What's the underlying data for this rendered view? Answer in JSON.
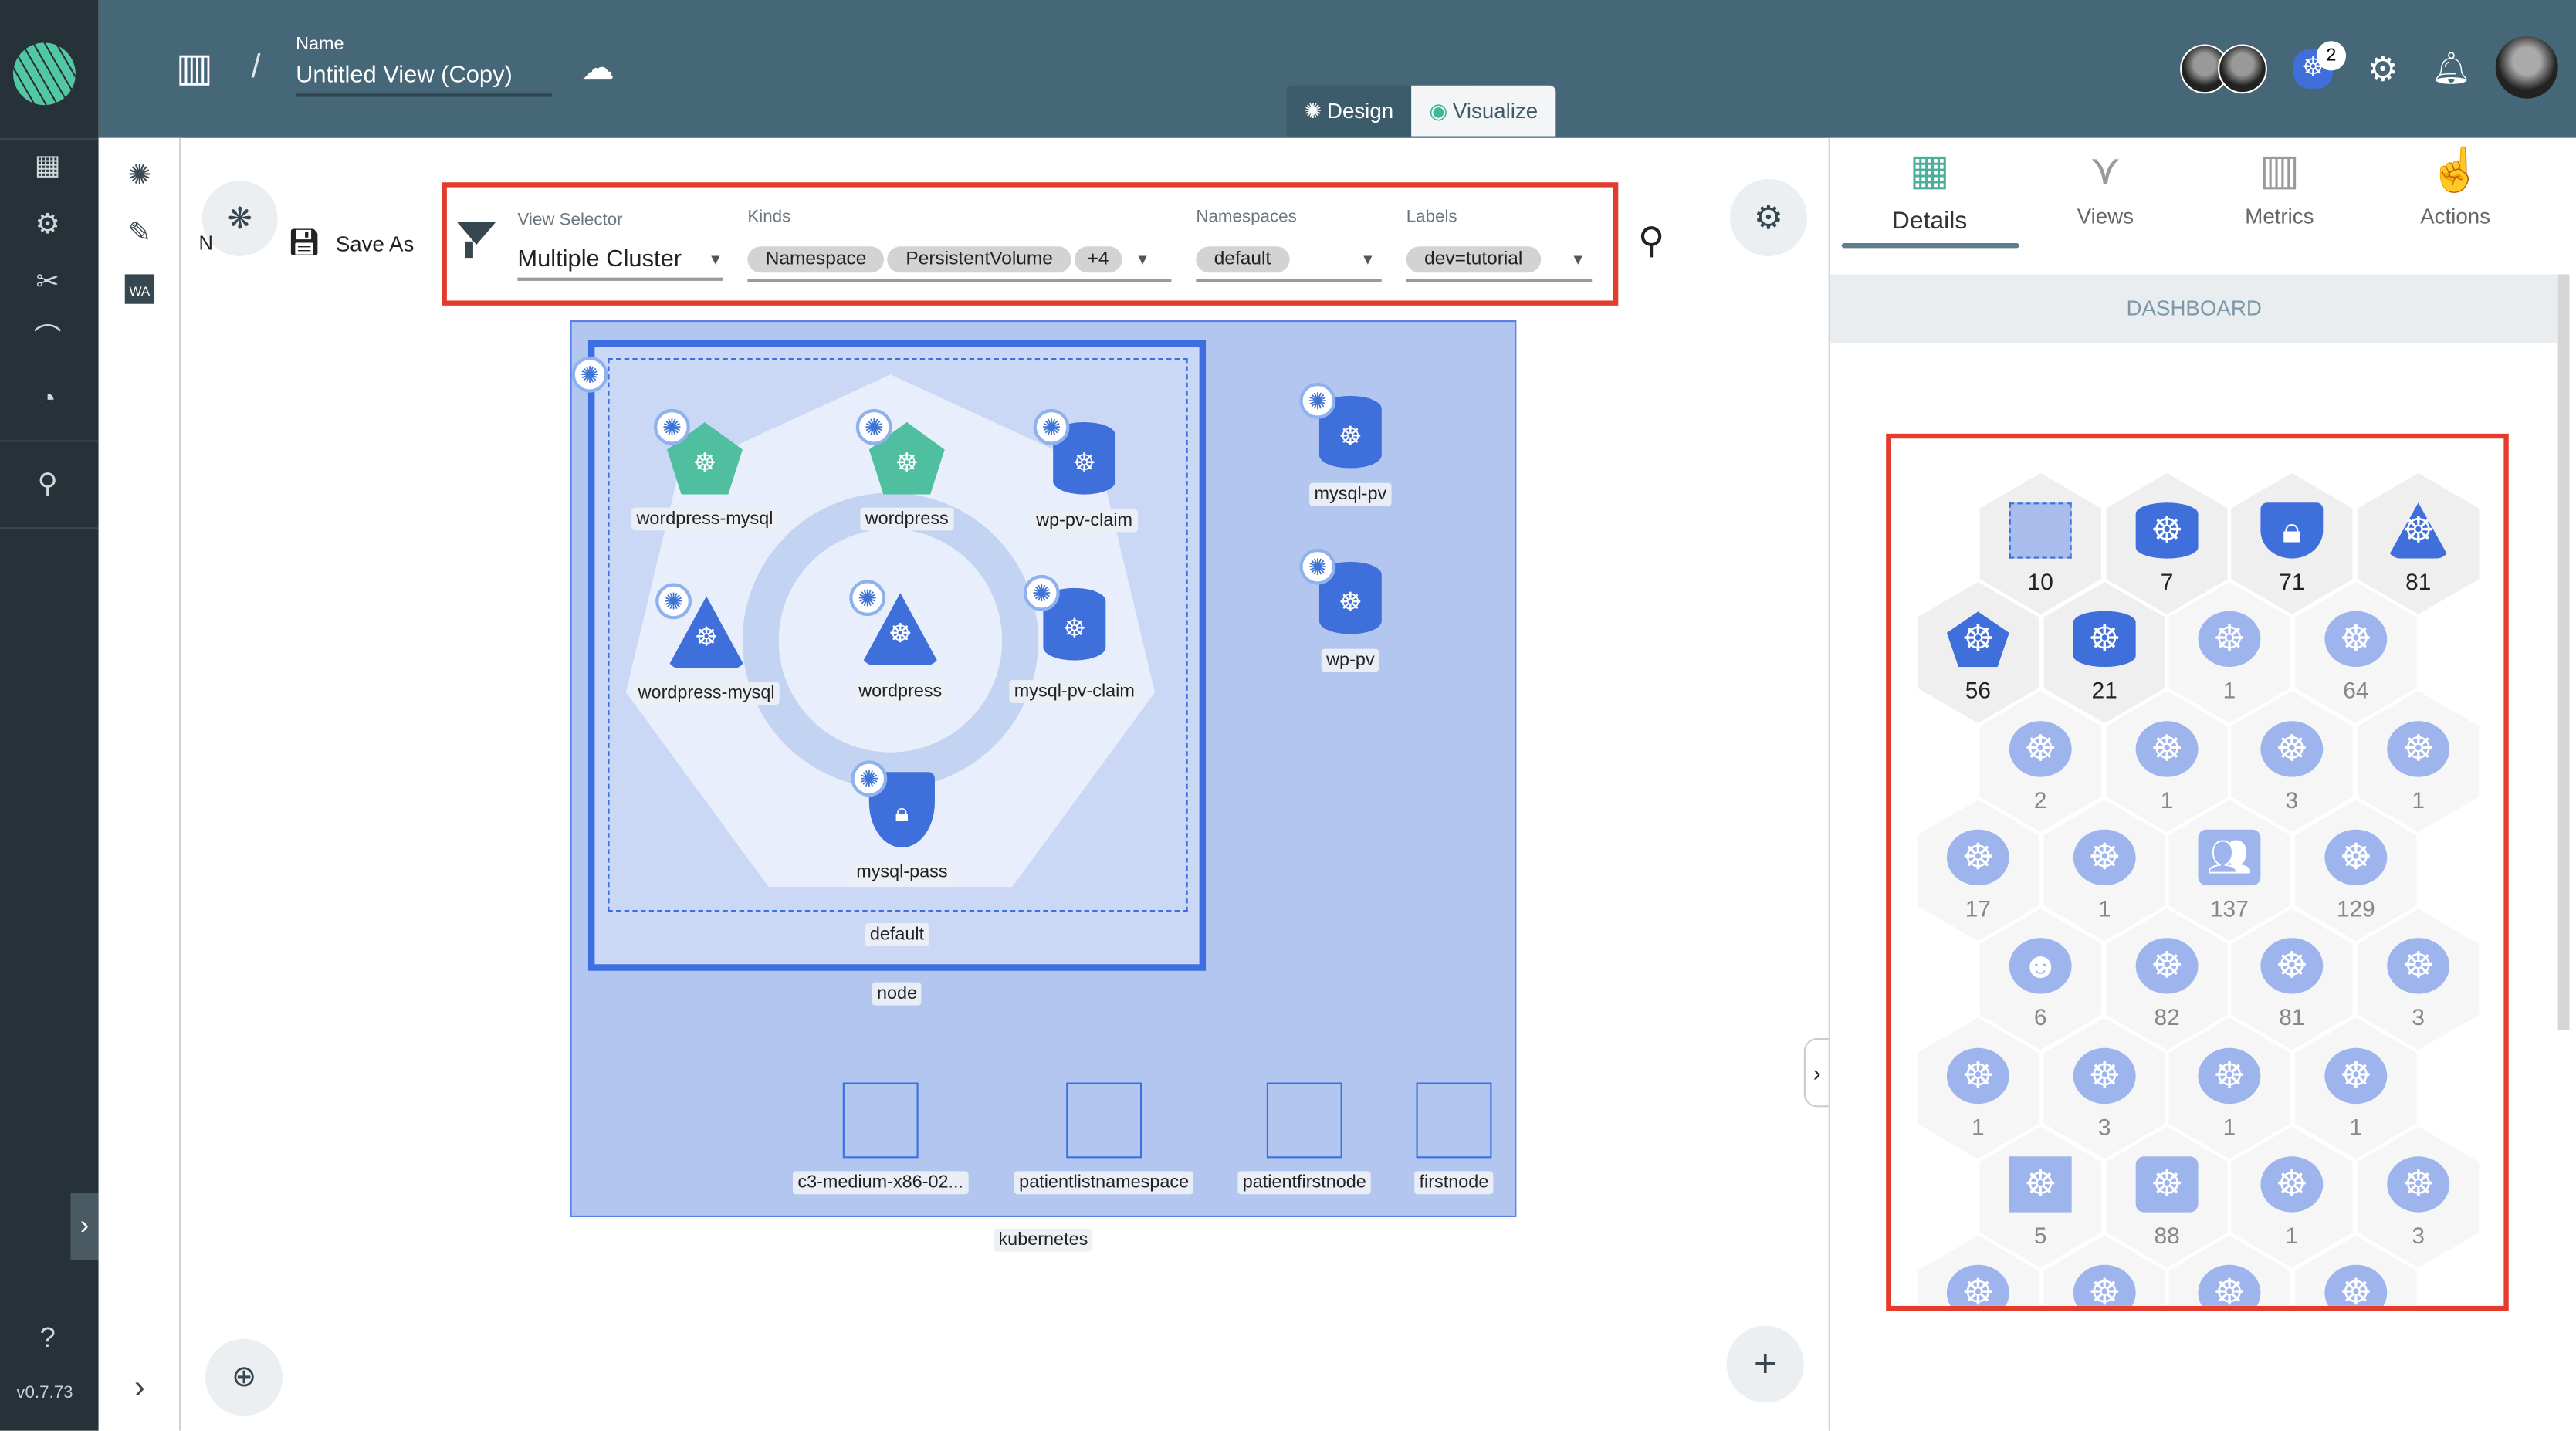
{
  "header": {
    "name_label": "Name",
    "title": "Untitled View (Copy)",
    "mode_design": "Design",
    "mode_visualize": "Visualize",
    "notification_count": "2"
  },
  "app": {
    "version": "v0.7.73"
  },
  "toolbar": {
    "save_as": "Save As",
    "obscured_label": "N"
  },
  "filters": {
    "view_selector": {
      "label": "View Selector",
      "value": "Multiple Cluster"
    },
    "kinds": {
      "label": "Kinds",
      "chips": [
        "Namespace",
        "PersistentVolume",
        "+4"
      ]
    },
    "namespaces": {
      "label": "Namespaces",
      "chips": [
        "default"
      ]
    },
    "labels": {
      "label": "Labels",
      "chips": [
        "dev=tutorial"
      ]
    }
  },
  "graph": {
    "outer_label": "kubernetes",
    "node_label": "node",
    "namespace_label": "default",
    "nodes": [
      {
        "label": "wordpress-mysql",
        "shape": "pentagon-teal"
      },
      {
        "label": "wordpress",
        "shape": "pentagon-teal"
      },
      {
        "label": "wp-pv-claim",
        "shape": "cylinder"
      },
      {
        "label": "wordpress-mysql",
        "shape": "triangle"
      },
      {
        "label": "wordpress",
        "shape": "triangle"
      },
      {
        "label": "mysql-pv-claim",
        "shape": "cylinder"
      },
      {
        "label": "mysql-pass",
        "shape": "shield"
      },
      {
        "label": "mysql-pv",
        "shape": "cylinder"
      },
      {
        "label": "wp-pv",
        "shape": "cylinder"
      }
    ],
    "clusters": [
      "c3-medium-x86-02...",
      "patientlistnamespace",
      "patientfirstnode",
      "firstnode"
    ]
  },
  "panel": {
    "tabs": [
      {
        "label": "Details",
        "icon": "dashboard-grid-icon",
        "active": true
      },
      {
        "label": "Views",
        "icon": "views-icon"
      },
      {
        "label": "Metrics",
        "icon": "chart-icon"
      },
      {
        "label": "Actions",
        "icon": "touch-icon"
      }
    ],
    "section": "DASHBOARD",
    "colors": {
      "solid": "#3f6fdb",
      "light": "#9db5ec",
      "accent": "#4caf9a"
    },
    "hex_rows": [
      [
        {
          "icon": "namespace-box",
          "count": "10",
          "solid": true
        },
        {
          "icon": "persistent-volume",
          "count": "7",
          "solid": true
        },
        {
          "icon": "secret",
          "count": "71",
          "solid": true
        },
        {
          "icon": "k8s-triangle",
          "count": "81",
          "solid": true
        }
      ],
      [
        {
          "icon": "k8s-pentagon",
          "count": "56",
          "solid": true
        },
        {
          "icon": "persistent-volume",
          "count": "21",
          "solid": true
        },
        {
          "icon": "k8s-circle",
          "count": "1"
        },
        {
          "icon": "k8s-circle",
          "count": "64"
        }
      ],
      [
        {
          "icon": "k8s-circle",
          "count": "2"
        },
        {
          "icon": "k8s-circle",
          "count": "1"
        },
        {
          "icon": "k8s-circle",
          "count": "3"
        },
        {
          "icon": "k8s-circle",
          "count": "1"
        }
      ],
      [
        {
          "icon": "k8s-circle",
          "count": "17"
        },
        {
          "icon": "k8s-circle",
          "count": "1"
        },
        {
          "icon": "users",
          "count": "137"
        },
        {
          "icon": "k8s-circle",
          "count": "129"
        }
      ],
      [
        {
          "icon": "devil",
          "count": "6"
        },
        {
          "icon": "k8s-circle",
          "count": "82"
        },
        {
          "icon": "k8s-circle",
          "count": "81"
        },
        {
          "icon": "k8s-circle",
          "count": "3"
        }
      ],
      [
        {
          "icon": "k8s-circle",
          "count": "1"
        },
        {
          "icon": "k8s-circle",
          "count": "3"
        },
        {
          "icon": "k8s-circle",
          "count": "1"
        },
        {
          "icon": "k8s-circle",
          "count": "1"
        }
      ],
      [
        {
          "icon": "k8s-square",
          "count": "5"
        },
        {
          "icon": "k8s-rounded",
          "count": "88"
        },
        {
          "icon": "k8s-circle",
          "count": "1"
        },
        {
          "icon": "k8s-circle",
          "count": "3"
        }
      ],
      [
        {
          "icon": "k8s-circle",
          "count": ""
        },
        {
          "icon": "k8s-circle",
          "count": ""
        },
        {
          "icon": "k8s-circle",
          "count": ""
        },
        {
          "icon": "k8s-circle",
          "count": ""
        }
      ]
    ]
  }
}
